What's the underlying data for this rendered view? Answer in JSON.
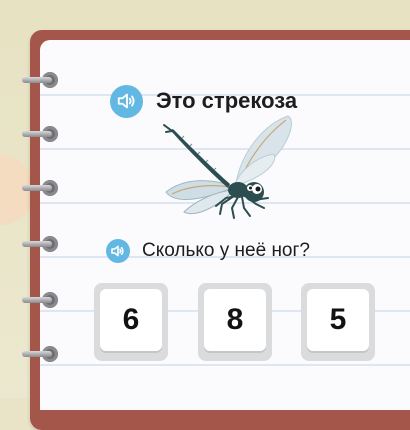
{
  "task": {
    "title": "Это стрекоза",
    "question": "Сколько у неё ног?",
    "subject_icon": "dragonfly-illustration",
    "audio_icon": "speaker-icon"
  },
  "answers": [
    {
      "label": "6"
    },
    {
      "label": "8"
    },
    {
      "label": "5"
    }
  ],
  "colors": {
    "speaker_accent": "#62b8e3",
    "notebook_cover": "#a4564a",
    "page": "#fbfbfd",
    "page_lines": "#dde6f2",
    "background": "#e9e4c8"
  }
}
